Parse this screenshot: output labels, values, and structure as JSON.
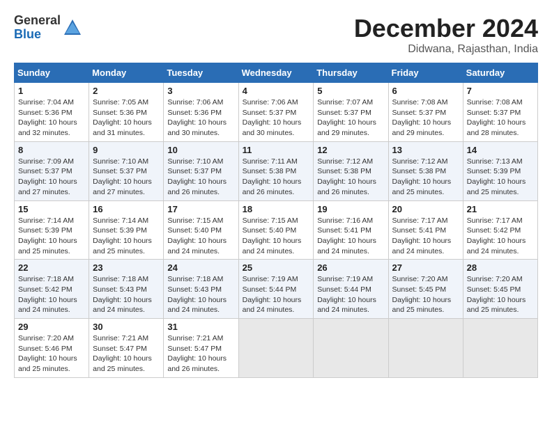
{
  "logo": {
    "general": "General",
    "blue": "Blue"
  },
  "title": "December 2024",
  "location": "Didwana, Rajasthan, India",
  "days_of_week": [
    "Sunday",
    "Monday",
    "Tuesday",
    "Wednesday",
    "Thursday",
    "Friday",
    "Saturday"
  ],
  "weeks": [
    [
      {
        "day": "1",
        "sunrise": "7:04 AM",
        "sunset": "5:36 PM",
        "daylight": "10 hours and 32 minutes."
      },
      {
        "day": "2",
        "sunrise": "7:05 AM",
        "sunset": "5:36 PM",
        "daylight": "10 hours and 31 minutes."
      },
      {
        "day": "3",
        "sunrise": "7:06 AM",
        "sunset": "5:36 PM",
        "daylight": "10 hours and 30 minutes."
      },
      {
        "day": "4",
        "sunrise": "7:06 AM",
        "sunset": "5:37 PM",
        "daylight": "10 hours and 30 minutes."
      },
      {
        "day": "5",
        "sunrise": "7:07 AM",
        "sunset": "5:37 PM",
        "daylight": "10 hours and 29 minutes."
      },
      {
        "day": "6",
        "sunrise": "7:08 AM",
        "sunset": "5:37 PM",
        "daylight": "10 hours and 29 minutes."
      },
      {
        "day": "7",
        "sunrise": "7:08 AM",
        "sunset": "5:37 PM",
        "daylight": "10 hours and 28 minutes."
      }
    ],
    [
      {
        "day": "8",
        "sunrise": "7:09 AM",
        "sunset": "5:37 PM",
        "daylight": "10 hours and 27 minutes."
      },
      {
        "day": "9",
        "sunrise": "7:10 AM",
        "sunset": "5:37 PM",
        "daylight": "10 hours and 27 minutes."
      },
      {
        "day": "10",
        "sunrise": "7:10 AM",
        "sunset": "5:37 PM",
        "daylight": "10 hours and 26 minutes."
      },
      {
        "day": "11",
        "sunrise": "7:11 AM",
        "sunset": "5:38 PM",
        "daylight": "10 hours and 26 minutes."
      },
      {
        "day": "12",
        "sunrise": "7:12 AM",
        "sunset": "5:38 PM",
        "daylight": "10 hours and 26 minutes."
      },
      {
        "day": "13",
        "sunrise": "7:12 AM",
        "sunset": "5:38 PM",
        "daylight": "10 hours and 25 minutes."
      },
      {
        "day": "14",
        "sunrise": "7:13 AM",
        "sunset": "5:39 PM",
        "daylight": "10 hours and 25 minutes."
      }
    ],
    [
      {
        "day": "15",
        "sunrise": "7:14 AM",
        "sunset": "5:39 PM",
        "daylight": "10 hours and 25 minutes."
      },
      {
        "day": "16",
        "sunrise": "7:14 AM",
        "sunset": "5:39 PM",
        "daylight": "10 hours and 25 minutes."
      },
      {
        "day": "17",
        "sunrise": "7:15 AM",
        "sunset": "5:40 PM",
        "daylight": "10 hours and 24 minutes."
      },
      {
        "day": "18",
        "sunrise": "7:15 AM",
        "sunset": "5:40 PM",
        "daylight": "10 hours and 24 minutes."
      },
      {
        "day": "19",
        "sunrise": "7:16 AM",
        "sunset": "5:41 PM",
        "daylight": "10 hours and 24 minutes."
      },
      {
        "day": "20",
        "sunrise": "7:17 AM",
        "sunset": "5:41 PM",
        "daylight": "10 hours and 24 minutes."
      },
      {
        "day": "21",
        "sunrise": "7:17 AM",
        "sunset": "5:42 PM",
        "daylight": "10 hours and 24 minutes."
      }
    ],
    [
      {
        "day": "22",
        "sunrise": "7:18 AM",
        "sunset": "5:42 PM",
        "daylight": "10 hours and 24 minutes."
      },
      {
        "day": "23",
        "sunrise": "7:18 AM",
        "sunset": "5:43 PM",
        "daylight": "10 hours and 24 minutes."
      },
      {
        "day": "24",
        "sunrise": "7:18 AM",
        "sunset": "5:43 PM",
        "daylight": "10 hours and 24 minutes."
      },
      {
        "day": "25",
        "sunrise": "7:19 AM",
        "sunset": "5:44 PM",
        "daylight": "10 hours and 24 minutes."
      },
      {
        "day": "26",
        "sunrise": "7:19 AM",
        "sunset": "5:44 PM",
        "daylight": "10 hours and 24 minutes."
      },
      {
        "day": "27",
        "sunrise": "7:20 AM",
        "sunset": "5:45 PM",
        "daylight": "10 hours and 25 minutes."
      },
      {
        "day": "28",
        "sunrise": "7:20 AM",
        "sunset": "5:45 PM",
        "daylight": "10 hours and 25 minutes."
      }
    ],
    [
      {
        "day": "29",
        "sunrise": "7:20 AM",
        "sunset": "5:46 PM",
        "daylight": "10 hours and 25 minutes."
      },
      {
        "day": "30",
        "sunrise": "7:21 AM",
        "sunset": "5:47 PM",
        "daylight": "10 hours and 25 minutes."
      },
      {
        "day": "31",
        "sunrise": "7:21 AM",
        "sunset": "5:47 PM",
        "daylight": "10 hours and 26 minutes."
      },
      null,
      null,
      null,
      null
    ]
  ],
  "labels": {
    "sunrise": "Sunrise:",
    "sunset": "Sunset:",
    "daylight": "Daylight:"
  }
}
